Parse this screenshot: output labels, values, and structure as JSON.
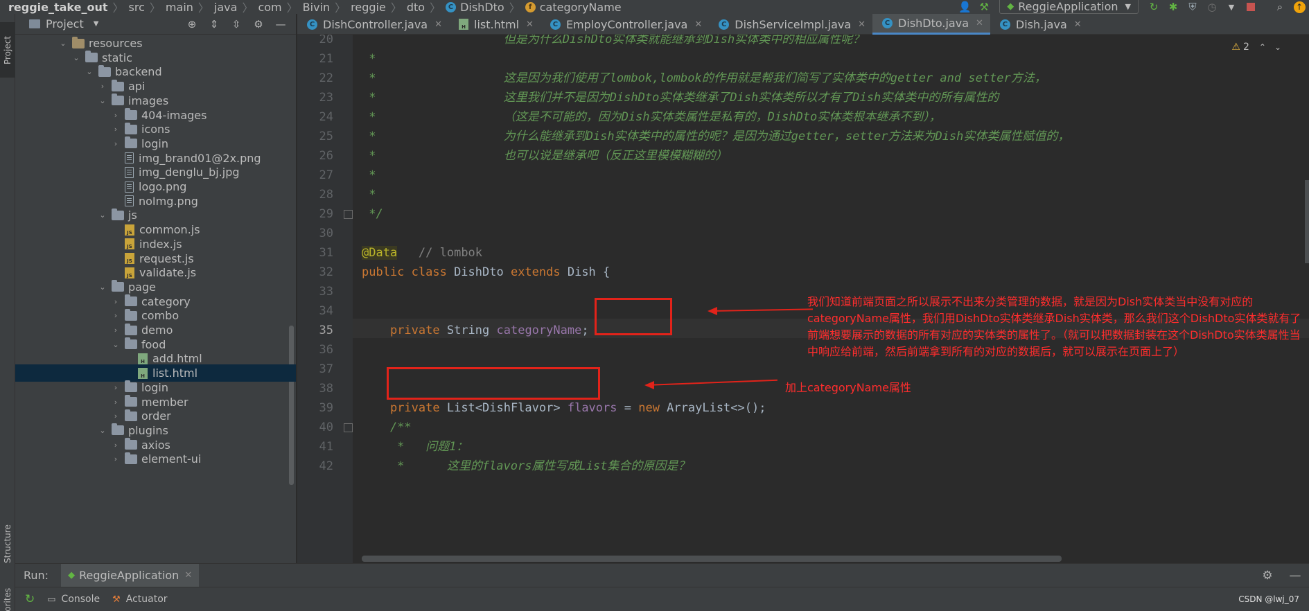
{
  "breadcrumbs": [
    "reggie_take_out",
    "src",
    "main",
    "java",
    "com",
    "Bivin",
    "reggie",
    "dto",
    "DishDto",
    "categoryName"
  ],
  "toolbar": {
    "run_config": "ReggieApplication"
  },
  "left_strip": {
    "project": "Project",
    "structure": "Structure",
    "favorites": "Favorites"
  },
  "project_panel": {
    "title": "Project",
    "tree": [
      {
        "label": "resources",
        "depth": 4,
        "type": "folder-res",
        "arrow": "down"
      },
      {
        "label": "static",
        "depth": 5,
        "type": "folder",
        "arrow": "down"
      },
      {
        "label": "backend",
        "depth": 6,
        "type": "folder",
        "arrow": "down"
      },
      {
        "label": "api",
        "depth": 7,
        "type": "folder",
        "arrow": "right"
      },
      {
        "label": "images",
        "depth": 7,
        "type": "folder",
        "arrow": "down"
      },
      {
        "label": "404-images",
        "depth": 8,
        "type": "folder",
        "arrow": "right"
      },
      {
        "label": "icons",
        "depth": 8,
        "type": "folder",
        "arrow": "right"
      },
      {
        "label": "login",
        "depth": 8,
        "type": "folder",
        "arrow": "right"
      },
      {
        "label": "img_brand01@2x.png",
        "depth": 8,
        "type": "img",
        "arrow": "none"
      },
      {
        "label": "img_denglu_bj.jpg",
        "depth": 8,
        "type": "img",
        "arrow": "none"
      },
      {
        "label": "logo.png",
        "depth": 8,
        "type": "img",
        "arrow": "none"
      },
      {
        "label": "noImg.png",
        "depth": 8,
        "type": "img",
        "arrow": "none"
      },
      {
        "label": "js",
        "depth": 7,
        "type": "folder",
        "arrow": "down"
      },
      {
        "label": "common.js",
        "depth": 8,
        "type": "js",
        "arrow": "none"
      },
      {
        "label": "index.js",
        "depth": 8,
        "type": "js",
        "arrow": "none"
      },
      {
        "label": "request.js",
        "depth": 8,
        "type": "js",
        "arrow": "none"
      },
      {
        "label": "validate.js",
        "depth": 8,
        "type": "js",
        "arrow": "none"
      },
      {
        "label": "page",
        "depth": 7,
        "type": "folder",
        "arrow": "down"
      },
      {
        "label": "category",
        "depth": 8,
        "type": "folder",
        "arrow": "right"
      },
      {
        "label": "combo",
        "depth": 8,
        "type": "folder",
        "arrow": "right"
      },
      {
        "label": "demo",
        "depth": 8,
        "type": "folder",
        "arrow": "right"
      },
      {
        "label": "food",
        "depth": 8,
        "type": "folder",
        "arrow": "down"
      },
      {
        "label": "add.html",
        "depth": 9,
        "type": "html",
        "arrow": "none"
      },
      {
        "label": "list.html",
        "depth": 9,
        "type": "html",
        "arrow": "none",
        "selected": true
      },
      {
        "label": "login",
        "depth": 8,
        "type": "folder",
        "arrow": "right"
      },
      {
        "label": "member",
        "depth": 8,
        "type": "folder",
        "arrow": "right"
      },
      {
        "label": "order",
        "depth": 8,
        "type": "folder",
        "arrow": "right"
      },
      {
        "label": "plugins",
        "depth": 7,
        "type": "folder",
        "arrow": "down"
      },
      {
        "label": "axios",
        "depth": 8,
        "type": "folder",
        "arrow": "right"
      },
      {
        "label": "element-ui",
        "depth": 8,
        "type": "folder",
        "arrow": "right"
      }
    ]
  },
  "tabs": [
    {
      "label": "DishController.java",
      "kind": "class",
      "active": false
    },
    {
      "label": "list.html",
      "kind": "html",
      "active": false
    },
    {
      "label": "EmployController.java",
      "kind": "class",
      "active": false
    },
    {
      "label": "DishServiceImpl.java",
      "kind": "class",
      "active": false
    },
    {
      "label": "DishDto.java",
      "kind": "class",
      "active": true
    },
    {
      "label": "Dish.java",
      "kind": "class",
      "active": false
    }
  ],
  "editor": {
    "warning_count": "2",
    "lines": [
      {
        "n": "20",
        "html": "<span class=\"cm\">                    但是为什么DishDto实体类就能继承到Dish实体类中的相应属性呢？</span>"
      },
      {
        "n": "21",
        "html": "<span class=\"cm\"> *</span>"
      },
      {
        "n": "22",
        "html": "<span class=\"cm\"> *                  这是因为我们使用了lombok,lombok的作用就是帮我们简写了实体类中的getter and setter方法，</span>"
      },
      {
        "n": "23",
        "html": "<span class=\"cm\"> *                  这里我们并不是因为DishDto实体类继承了Dish实体类所以才有了Dish实体类中的所有属性的</span>"
      },
      {
        "n": "24",
        "html": "<span class=\"cm\"> *                  （这是不可能的，因为Dish实体类属性是私有的，DishDto实体类根本继承不到），</span>"
      },
      {
        "n": "25",
        "html": "<span class=\"cm\"> *                  为什么能继承到Dish实体类中的属性的呢？是因为通过getter，setter方法来为Dish实体类属性赋值的，</span>"
      },
      {
        "n": "26",
        "html": "<span class=\"cm\"> *                  也可以说是继承吧（反正这里模模糊糊的）</span>"
      },
      {
        "n": "27",
        "html": "<span class=\"cm\"> *</span>"
      },
      {
        "n": "28",
        "html": "<span class=\"cm\"> *</span>"
      },
      {
        "n": "29",
        "html": "<span class=\"cm\"> */</span>"
      },
      {
        "n": "30",
        "html": ""
      },
      {
        "n": "31",
        "html": "<span class=\"ann\">@Data</span>   <span class=\"lc\">// lombok</span>"
      },
      {
        "n": "32",
        "html": "<span class=\"kw\">public class</span> DishDto <span class=\"kw\">extends</span> Dish {"
      },
      {
        "n": "33",
        "html": ""
      },
      {
        "n": "34",
        "html": ""
      },
      {
        "n": "35",
        "html": "    <span class=\"kw\">private</span> String <span class=\"fieldname\">categoryName</span>;",
        "current": true
      },
      {
        "n": "36",
        "html": ""
      },
      {
        "n": "37",
        "html": ""
      },
      {
        "n": "38",
        "html": ""
      },
      {
        "n": "39",
        "html": "    <span class=\"kw\">private</span> List&lt;DishFlavor&gt; <span class=\"fieldname\">flavors</span> = <span class=\"kw\">new</span> ArrayList&lt;&gt;();"
      },
      {
        "n": "40",
        "html": "    <span class=\"cm\">/**</span>"
      },
      {
        "n": "41",
        "html": "<span class=\"cm\">     *   问题1：</span>"
      },
      {
        "n": "42",
        "html": "<span class=\"cm\">     *      这里的flavors属性写成List集合的原因是？</span>"
      }
    ]
  },
  "annotations": {
    "note1": "我们知道前端页面之所以展示不出来分类管理的数据，就是因为Dish实体类当中没有对应的categoryName属性，我们用DishDto实体类继承Dish实体类，那么我们这个DishDto实体类就有了前端想要展示的数据的所有对应的实体类的属性了。（就可以把数据封装在这个DishDto实体类属性当中响应给前端，然后前端拿到所有的对应的数据后，就可以展示在页面上了）",
    "note2": "加上categoryName属性"
  },
  "run_panel": {
    "label": "Run:",
    "tab": "ReggieApplication",
    "console": "Console",
    "actuator": "Actuator"
  },
  "watermark": "CSDN @lwj_07"
}
